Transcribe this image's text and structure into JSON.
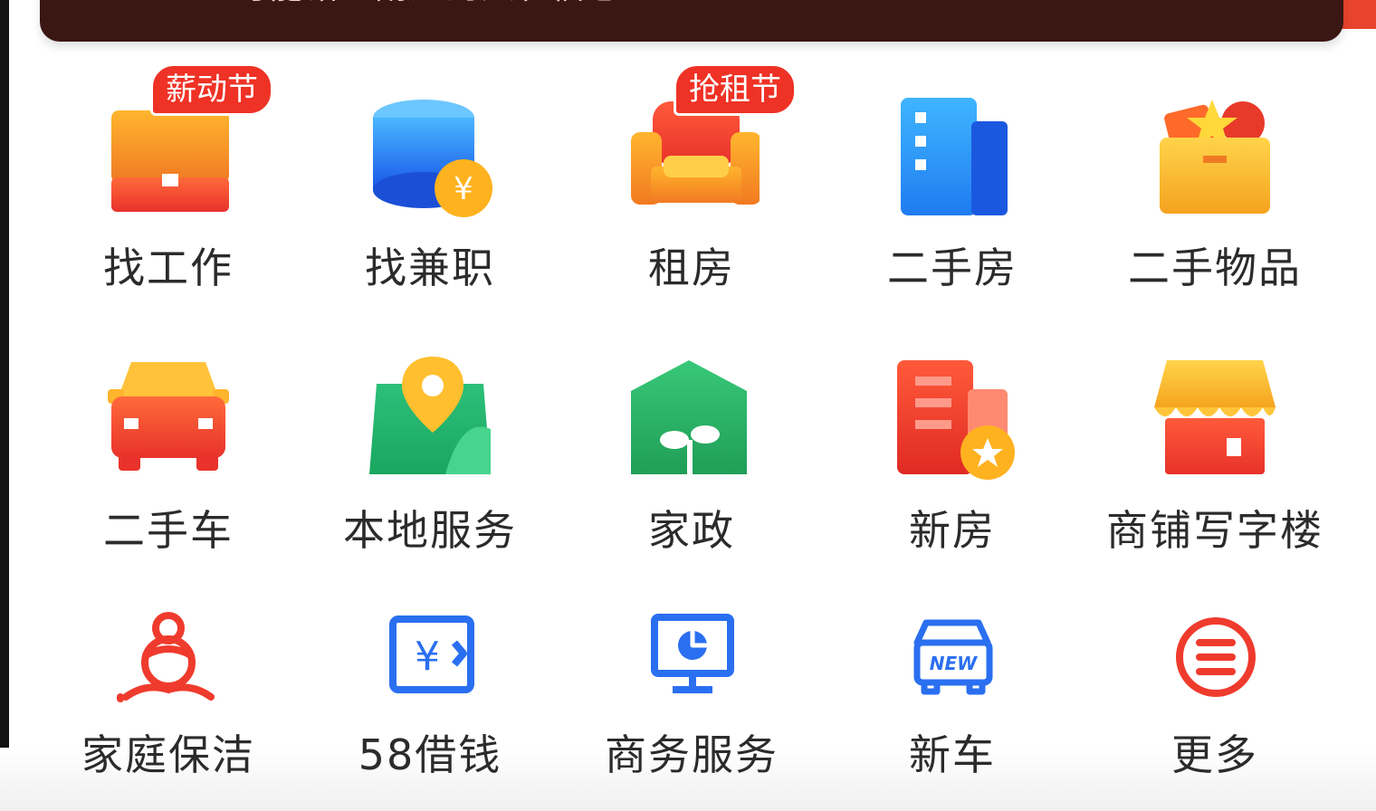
{
  "banner": {
    "text": "可能错过附近的人和信息"
  },
  "grid": {
    "items": [
      {
        "label": "找工作",
        "icon": "briefcase-icon",
        "badge": "薪动节"
      },
      {
        "label": "找兼职",
        "icon": "coin-stack-icon"
      },
      {
        "label": "租房",
        "icon": "sofa-icon",
        "badge": "抢租节"
      },
      {
        "label": "二手房",
        "icon": "building-icon"
      },
      {
        "label": "二手物品",
        "icon": "box-icon"
      },
      {
        "label": "二手车",
        "icon": "car-icon"
      },
      {
        "label": "本地服务",
        "icon": "map-pin-icon"
      },
      {
        "label": "家政",
        "icon": "house-sprout-icon"
      },
      {
        "label": "新房",
        "icon": "new-building-icon"
      },
      {
        "label": "商铺写字楼",
        "icon": "storefront-icon"
      },
      {
        "label": "家庭保洁",
        "icon": "cleaner-icon"
      },
      {
        "label": "58借钱",
        "icon": "yuan-ticket-icon"
      },
      {
        "label": "商务服务",
        "icon": "monitor-chart-icon"
      },
      {
        "label": "新车",
        "icon": "new-car-icon"
      },
      {
        "label": "更多",
        "icon": "more-menu-icon"
      }
    ]
  },
  "colors": {
    "accent_red": "#ee3225",
    "banner_bg": "#3b1713",
    "text": "#2b2b2b"
  }
}
